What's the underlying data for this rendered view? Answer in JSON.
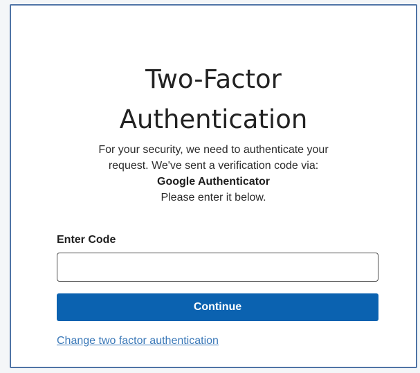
{
  "title": {
    "line1": "Two-Factor",
    "line2": "Authentication"
  },
  "description": {
    "line1": "For your security, we need to authenticate your",
    "line2": "request. We've sent a verification code via:",
    "method": "Google Authenticator",
    "line4": "Please enter it below."
  },
  "code_field": {
    "label": "Enter Code",
    "value": "",
    "placeholder": ""
  },
  "continue_button": {
    "label": "Continue",
    "color": "#0b62b0"
  },
  "change_link": {
    "label": "Change two factor authentication",
    "color": "#3a78b8"
  },
  "colors": {
    "card_border": "#4f74a6"
  }
}
